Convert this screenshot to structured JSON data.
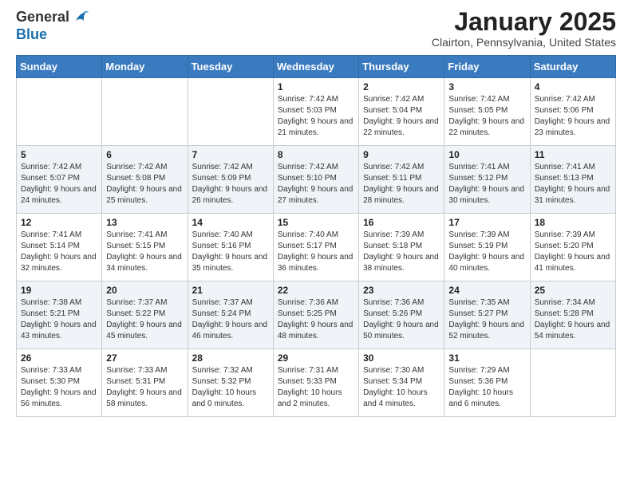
{
  "header": {
    "logo_general": "General",
    "logo_blue": "Blue",
    "month_title": "January 2025",
    "location": "Clairton, Pennsylvania, United States"
  },
  "weekdays": [
    "Sunday",
    "Monday",
    "Tuesday",
    "Wednesday",
    "Thursday",
    "Friday",
    "Saturday"
  ],
  "weeks": [
    [
      {
        "day": "",
        "info": ""
      },
      {
        "day": "",
        "info": ""
      },
      {
        "day": "",
        "info": ""
      },
      {
        "day": "1",
        "info": "Sunrise: 7:42 AM\nSunset: 5:03 PM\nDaylight: 9 hours and 21 minutes."
      },
      {
        "day": "2",
        "info": "Sunrise: 7:42 AM\nSunset: 5:04 PM\nDaylight: 9 hours and 22 minutes."
      },
      {
        "day": "3",
        "info": "Sunrise: 7:42 AM\nSunset: 5:05 PM\nDaylight: 9 hours and 22 minutes."
      },
      {
        "day": "4",
        "info": "Sunrise: 7:42 AM\nSunset: 5:06 PM\nDaylight: 9 hours and 23 minutes."
      }
    ],
    [
      {
        "day": "5",
        "info": "Sunrise: 7:42 AM\nSunset: 5:07 PM\nDaylight: 9 hours and 24 minutes."
      },
      {
        "day": "6",
        "info": "Sunrise: 7:42 AM\nSunset: 5:08 PM\nDaylight: 9 hours and 25 minutes."
      },
      {
        "day": "7",
        "info": "Sunrise: 7:42 AM\nSunset: 5:09 PM\nDaylight: 9 hours and 26 minutes."
      },
      {
        "day": "8",
        "info": "Sunrise: 7:42 AM\nSunset: 5:10 PM\nDaylight: 9 hours and 27 minutes."
      },
      {
        "day": "9",
        "info": "Sunrise: 7:42 AM\nSunset: 5:11 PM\nDaylight: 9 hours and 28 minutes."
      },
      {
        "day": "10",
        "info": "Sunrise: 7:41 AM\nSunset: 5:12 PM\nDaylight: 9 hours and 30 minutes."
      },
      {
        "day": "11",
        "info": "Sunrise: 7:41 AM\nSunset: 5:13 PM\nDaylight: 9 hours and 31 minutes."
      }
    ],
    [
      {
        "day": "12",
        "info": "Sunrise: 7:41 AM\nSunset: 5:14 PM\nDaylight: 9 hours and 32 minutes."
      },
      {
        "day": "13",
        "info": "Sunrise: 7:41 AM\nSunset: 5:15 PM\nDaylight: 9 hours and 34 minutes."
      },
      {
        "day": "14",
        "info": "Sunrise: 7:40 AM\nSunset: 5:16 PM\nDaylight: 9 hours and 35 minutes."
      },
      {
        "day": "15",
        "info": "Sunrise: 7:40 AM\nSunset: 5:17 PM\nDaylight: 9 hours and 36 minutes."
      },
      {
        "day": "16",
        "info": "Sunrise: 7:39 AM\nSunset: 5:18 PM\nDaylight: 9 hours and 38 minutes."
      },
      {
        "day": "17",
        "info": "Sunrise: 7:39 AM\nSunset: 5:19 PM\nDaylight: 9 hours and 40 minutes."
      },
      {
        "day": "18",
        "info": "Sunrise: 7:39 AM\nSunset: 5:20 PM\nDaylight: 9 hours and 41 minutes."
      }
    ],
    [
      {
        "day": "19",
        "info": "Sunrise: 7:38 AM\nSunset: 5:21 PM\nDaylight: 9 hours and 43 minutes."
      },
      {
        "day": "20",
        "info": "Sunrise: 7:37 AM\nSunset: 5:22 PM\nDaylight: 9 hours and 45 minutes."
      },
      {
        "day": "21",
        "info": "Sunrise: 7:37 AM\nSunset: 5:24 PM\nDaylight: 9 hours and 46 minutes."
      },
      {
        "day": "22",
        "info": "Sunrise: 7:36 AM\nSunset: 5:25 PM\nDaylight: 9 hours and 48 minutes."
      },
      {
        "day": "23",
        "info": "Sunrise: 7:36 AM\nSunset: 5:26 PM\nDaylight: 9 hours and 50 minutes."
      },
      {
        "day": "24",
        "info": "Sunrise: 7:35 AM\nSunset: 5:27 PM\nDaylight: 9 hours and 52 minutes."
      },
      {
        "day": "25",
        "info": "Sunrise: 7:34 AM\nSunset: 5:28 PM\nDaylight: 9 hours and 54 minutes."
      }
    ],
    [
      {
        "day": "26",
        "info": "Sunrise: 7:33 AM\nSunset: 5:30 PM\nDaylight: 9 hours and 56 minutes."
      },
      {
        "day": "27",
        "info": "Sunrise: 7:33 AM\nSunset: 5:31 PM\nDaylight: 9 hours and 58 minutes."
      },
      {
        "day": "28",
        "info": "Sunrise: 7:32 AM\nSunset: 5:32 PM\nDaylight: 10 hours and 0 minutes."
      },
      {
        "day": "29",
        "info": "Sunrise: 7:31 AM\nSunset: 5:33 PM\nDaylight: 10 hours and 2 minutes."
      },
      {
        "day": "30",
        "info": "Sunrise: 7:30 AM\nSunset: 5:34 PM\nDaylight: 10 hours and 4 minutes."
      },
      {
        "day": "31",
        "info": "Sunrise: 7:29 AM\nSunset: 5:36 PM\nDaylight: 10 hours and 6 minutes."
      },
      {
        "day": "",
        "info": ""
      }
    ]
  ]
}
